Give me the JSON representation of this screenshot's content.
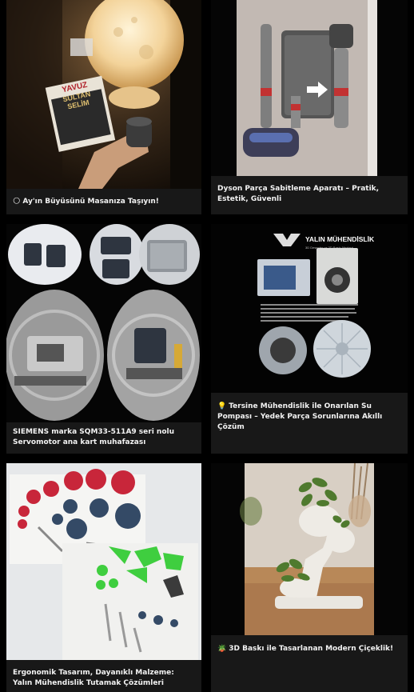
{
  "cards": [
    {
      "emoji": "🌕",
      "title": "Ay'ın Büyüsünü Masanıza Taşıyın!"
    },
    {
      "emoji": "",
      "title": "Dyson Parça Sabitleme Aparatı – Pratik, Estetik, Güvenli"
    },
    {
      "emoji": "",
      "title": "SIEMENS marka SQM33-511A9 seri nolu Servomotor ana kart muhafazası"
    },
    {
      "emoji": "💡",
      "title": "Tersine Mühendislik ile Onarılan Su Pompası – Yedek Parça Sorunlarına Akıllı Çözüm",
      "image_brand": "YALIN MÜHENDİSLİK",
      "image_tagline": "3D Desenler ve 3D Baskı Merkezi"
    },
    {
      "emoji": "",
      "title": "Ergonomik Tasarım, Dayanıklı Malzeme: Yalın Mühendislik Tutamak Çözümleri"
    },
    {
      "emoji": "🪴",
      "title": "3D Baskı ile Tasarlanan Modern Çiçeklik!"
    }
  ],
  "book": {
    "line1": "YAVUZ",
    "line2": "SULTAN",
    "line3": "SELİM"
  },
  "colors": {
    "page_bg": "#000000",
    "card_bg": "#181818",
    "caption": "#f2f2f2",
    "knob_red": "#c8263a",
    "knob_blue": "#344a66",
    "knob_green": "#3fce3f"
  }
}
